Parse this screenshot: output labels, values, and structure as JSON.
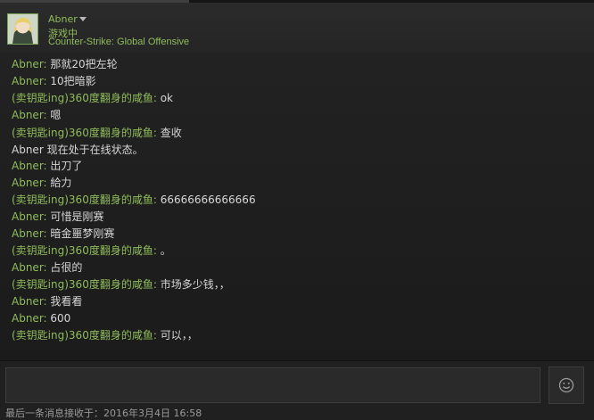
{
  "header": {
    "name": "Abner",
    "status": "游戏中",
    "game": "Counter-Strike: Global Offensive"
  },
  "messages": [
    {
      "sender": "Abner",
      "sep": ": ",
      "text": "那就20把左轮"
    },
    {
      "sender": "Abner",
      "sep": ": ",
      "text": "10把暗影"
    },
    {
      "sender": "(卖钥匙ing)360度翻身的咸鱼",
      "sep": ": ",
      "text": "ok"
    },
    {
      "sender": "Abner",
      "sep": ": ",
      "text": "嗯"
    },
    {
      "sender": "(卖钥匙ing)360度翻身的咸鱼",
      "sep": ": ",
      "text": "查收"
    },
    {
      "system": "Abner 现在处于在线状态。"
    },
    {
      "sender": "Abner",
      "sep": ": ",
      "text": "出刀了"
    },
    {
      "sender": "Abner",
      "sep": ": ",
      "text": "給力"
    },
    {
      "sender": "(卖钥匙ing)360度翻身的咸鱼",
      "sep": ": ",
      "text": "66666666666666"
    },
    {
      "sender": "Abner",
      "sep": ": ",
      "text": "可惜是刚赛"
    },
    {
      "sender": "Abner",
      "sep": ": ",
      "text": "暗金噩梦刚赛"
    },
    {
      "sender": "(卖钥匙ing)360度翻身的咸鱼",
      "sep": ": ",
      "text": "。"
    },
    {
      "sender": "Abner",
      "sep": ": ",
      "text": "占很的"
    },
    {
      "sender": "(卖钥匙ing)360度翻身的咸鱼",
      "sep": ": ",
      "text": "市场多少钱，，"
    },
    {
      "sender": "Abner",
      "sep": ": ",
      "text": "我看看"
    },
    {
      "sender": "Abner",
      "sep": ": ",
      "text": "600"
    },
    {
      "sender": "(卖钥匙ing)360度翻身的咸鱼",
      "sep": ": ",
      "text": "可以，，"
    }
  ],
  "input": {
    "value": "",
    "placeholder": ""
  },
  "footer": {
    "last_received": "最后一条消息接收于：2016年3月4日 16:58"
  },
  "icons": {
    "menu_caret": "chevron-down-icon",
    "emoji": "emoticon-icon"
  },
  "colors": {
    "accent_green": "#8fbc5b",
    "text": "#d6d6d6",
    "background": "#232323"
  }
}
